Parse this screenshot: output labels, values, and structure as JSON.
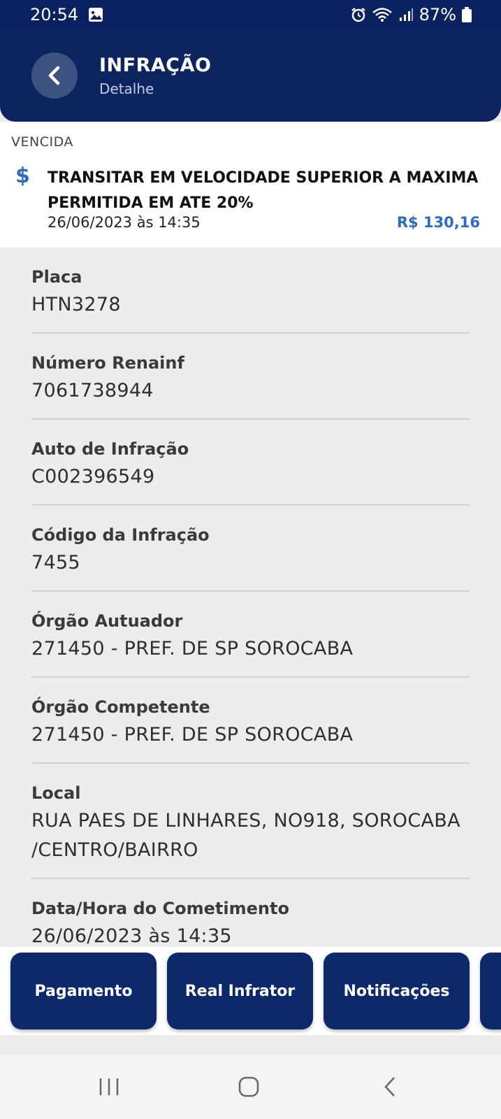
{
  "status_bar": {
    "time": "20:54",
    "battery": "87%"
  },
  "header": {
    "title": "INFRAÇÃO",
    "subtitle": "Detalhe"
  },
  "summary": {
    "status": "VENCIDA",
    "description": "TRANSITAR EM VELOCIDADE SUPERIOR A MAXIMA PERMITIDA EM ATE 20%",
    "datetime": "26/06/2023 às 14:35",
    "amount": "R$ 130,16"
  },
  "details": [
    {
      "label": "Placa",
      "value": "HTN3278"
    },
    {
      "label": "Número Renainf",
      "value": "7061738944"
    },
    {
      "label": "Auto de Infração",
      "value": "C002396549"
    },
    {
      "label": "Código da Infração",
      "value": "7455"
    },
    {
      "label": "Órgão Autuador",
      "value": "271450 - PREF. DE SP SOROCABA"
    },
    {
      "label": "Órgão Competente",
      "value": "271450 - PREF. DE SP SOROCABA"
    },
    {
      "label": "Local",
      "value": "RUA PAES DE LINHARES, NO918, SOROCABA /CENTRO/BAIRRO"
    },
    {
      "label": "Data/Hora do Cometimento",
      "value": "26/06/2023 às 14:35"
    }
  ],
  "actions": {
    "payment": "Pagamento",
    "real_offender": "Real Infrator",
    "notifications": "Notificações"
  },
  "colors": {
    "primary": "#0c2a6a",
    "accent": "#2d6cc0"
  }
}
